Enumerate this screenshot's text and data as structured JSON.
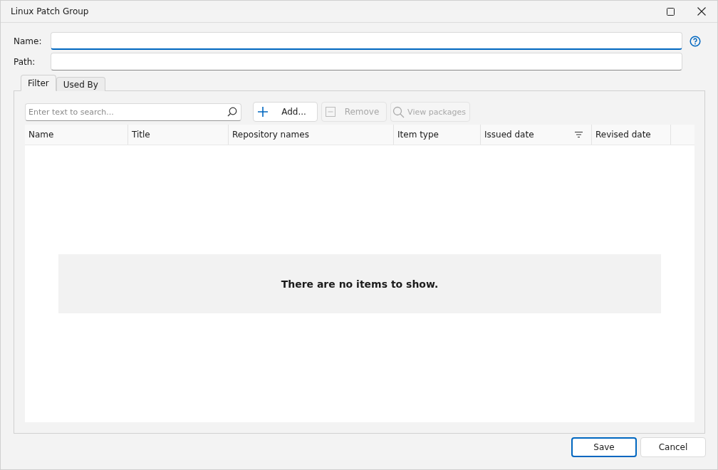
{
  "window": {
    "title": "Linux Patch Group"
  },
  "fields": [
    {
      "label": "Name:",
      "focused": true
    },
    {
      "label": "Path:",
      "focused": false
    }
  ],
  "tabs": [
    {
      "label": "Filter",
      "selected": true
    },
    {
      "label": "Used By",
      "selected": false
    }
  ],
  "search": {
    "placeholder": "Enter text to search..."
  },
  "toolbar": [
    {
      "kind": "add",
      "label": "Add...",
      "disabled": false
    },
    {
      "kind": "remove",
      "label": "Remove",
      "disabled": true
    },
    {
      "kind": "view",
      "label": "View packages",
      "disabled": true
    }
  ],
  "table": {
    "columns": [
      {
        "label": "Name",
        "filtered": false
      },
      {
        "label": "Title",
        "filtered": false
      },
      {
        "label": "Repository names",
        "filtered": false
      },
      {
        "label": "Item type",
        "filtered": false
      },
      {
        "label": "Issued date",
        "filtered": true
      },
      {
        "label": "Revised date",
        "filtered": false
      }
    ],
    "empty_message": "There are no items to show."
  },
  "buttons": [
    {
      "label": "Save",
      "default": true
    },
    {
      "label": "Cancel",
      "default": false
    }
  ]
}
